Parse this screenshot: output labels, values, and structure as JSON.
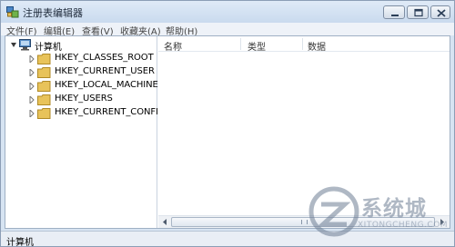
{
  "window": {
    "title": "注册表编辑器"
  },
  "menu": [
    {
      "label": "文件(F)"
    },
    {
      "label": "编辑(E)"
    },
    {
      "label": "查看(V)"
    },
    {
      "label": "收藏夹(A)"
    },
    {
      "label": "帮助(H)"
    }
  ],
  "tree": {
    "root": "计算机",
    "children": [
      {
        "label": "HKEY_CLASSES_ROOT"
      },
      {
        "label": "HKEY_CURRENT_USER"
      },
      {
        "label": "HKEY_LOCAL_MACHINE"
      },
      {
        "label": "HKEY_USERS"
      },
      {
        "label": "HKEY_CURRENT_CONFIG"
      }
    ]
  },
  "list": {
    "columns": [
      "名称",
      "类型",
      "数据"
    ]
  },
  "status": {
    "text": "计算机"
  },
  "watermark": {
    "text": "系统城",
    "sub": "XITONGCHENG.COM"
  },
  "icons": {
    "app": "regedit-icon",
    "computer": "computer-icon",
    "folder": "folder-icon",
    "expander": "expander-triangle-icon",
    "minimize": "minimize-icon",
    "maximize": "maximize-icon",
    "close": "close-icon"
  },
  "colors": {
    "titlebar": "#c9daee",
    "folder": "#e8c35a",
    "close_glyph": "#2b3e57"
  }
}
